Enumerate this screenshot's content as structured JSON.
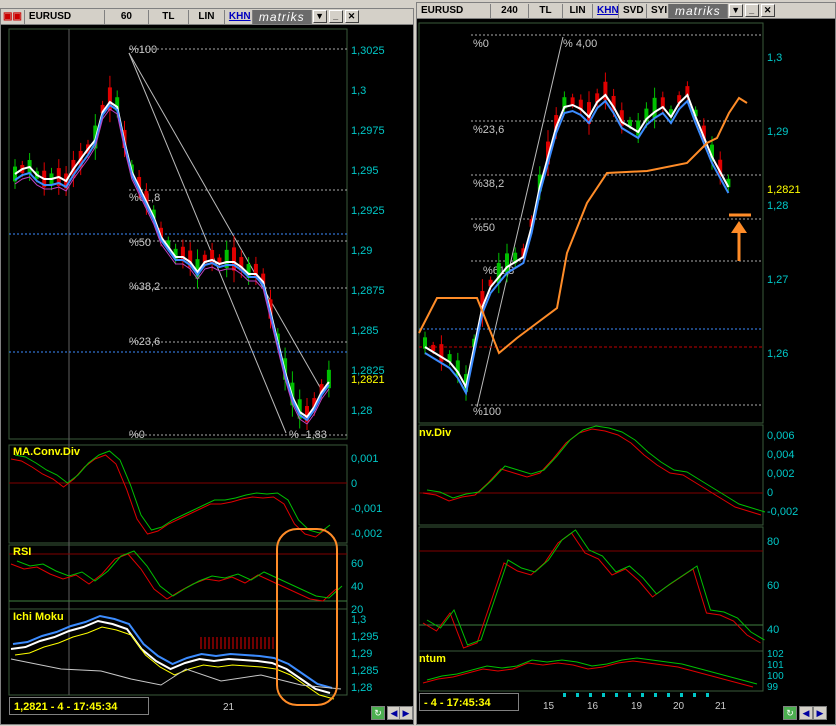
{
  "left_window": {
    "symbol": "EURUSD",
    "period": "60",
    "currency": "TL",
    "scale": "LIN",
    "mode": "KHN",
    "brand": "matriks",
    "price_axis": [
      "1,3025",
      "1,3",
      "1,2975",
      "1,295",
      "1,2925",
      "1,29",
      "1,2875",
      "1,285",
      "1,2825",
      "1,28"
    ],
    "current_price": "1,2821",
    "fib_labels": [
      "%100",
      "%61,8",
      "%50",
      "%38,2",
      "%23,6",
      "%0",
      "% -1,83"
    ],
    "macd_label": "MA.Conv.Div",
    "macd_axis": [
      "0,001",
      "0",
      "-0,001",
      "-0,002"
    ],
    "rsi_label": "RSI",
    "rsi_axis": [
      "60",
      "40",
      "20"
    ],
    "ichi_label": "Ichi Moku",
    "ichi_axis": [
      "1,3",
      "1,295",
      "1,29",
      "1,285",
      "1,28"
    ],
    "status": "1,2821 - 4 - 17:45:34",
    "date_label": "21"
  },
  "right_window": {
    "symbol": "EURUSD",
    "period": "240",
    "currency": "TL",
    "scale": "LIN",
    "mode": "KHN",
    "extra1": "SVD",
    "extra2": "SYI",
    "brand": "matriks",
    "price_axis": [
      "1,3",
      "1,29",
      "1,28",
      "1,27",
      "1,26"
    ],
    "current_price": "1,2821",
    "fib_labels": [
      "%0",
      "% 4,00",
      "%23,6",
      "%38,2",
      "%50",
      "%61,8",
      "%100"
    ],
    "macd_label": "nv.Div",
    "macd_axis": [
      "0,006",
      "0,004",
      "0,002",
      "0",
      "-0,002"
    ],
    "rsi_axis": [
      "80",
      "60",
      "40"
    ],
    "mom_label": "ntum",
    "mom_axis": [
      "102",
      "101",
      "100",
      "99"
    ],
    "status": "- 4 - 17:45:34",
    "date_labels": [
      "15",
      "16",
      "19",
      "20",
      "21"
    ]
  },
  "colors": {
    "bull": "#00c000",
    "bear": "#e00000",
    "ma_white": "#ffffff",
    "ma_blue": "#3c8cff",
    "ma_orange": "#ff8c28",
    "axis": "#00c8c8",
    "label": "#ffff00",
    "circle": "#ff8c28"
  }
}
